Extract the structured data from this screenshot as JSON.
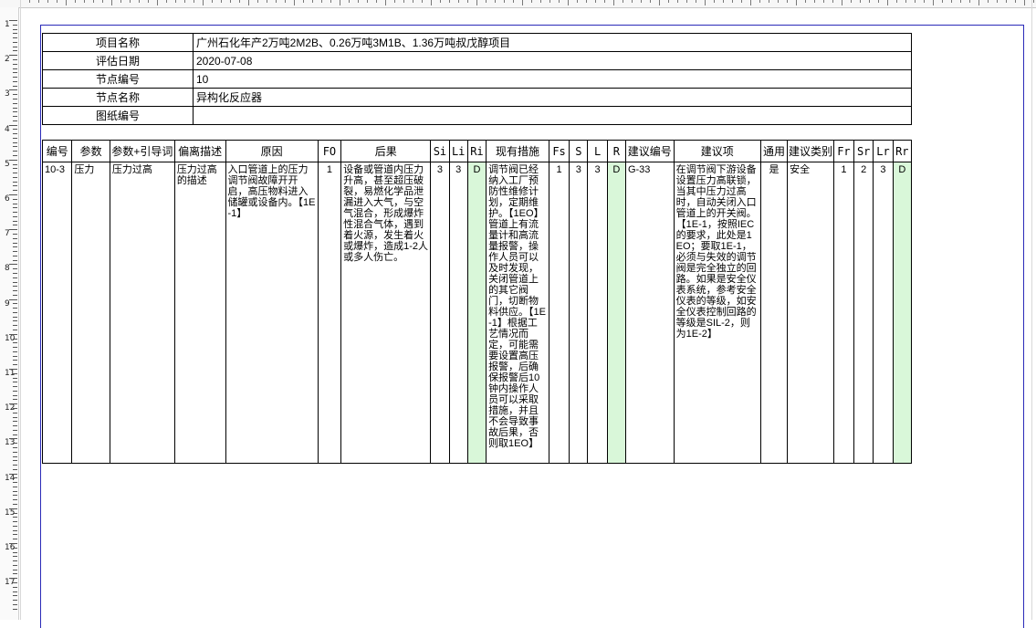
{
  "info": {
    "rows": [
      {
        "label": "项目名称",
        "value": "广州石化年产2万吨2M2B、0.26万吨3M1B、1.36万吨叔戊醇项目"
      },
      {
        "label": "评估日期",
        "value": "2020-07-08"
      },
      {
        "label": "节点编号",
        "value": "10"
      },
      {
        "label": "节点名称",
        "value": "异构化反应器"
      },
      {
        "label": "图纸编号",
        "value": ""
      }
    ]
  },
  "table": {
    "headers": [
      "编号",
      "参数",
      "参数+引导词",
      "偏离描述",
      "原因",
      "FO",
      "后果",
      "Si",
      "Li",
      "Ri",
      "现有措施",
      "Fs",
      "S",
      "L",
      "R",
      "建议编号",
      "建议项",
      "通用",
      "建议类别",
      "Fr",
      "Sr",
      "Lr",
      "Rr"
    ],
    "row": {
      "id": "10-3",
      "param": "压力",
      "param_guide": "压力过高",
      "deviation": "压力过高的描述",
      "cause": "入口管道上的压力调节阀故障开开启，高压物料进入储罐或设备内。【1E-1】",
      "fo": "1",
      "consequence": "设备或管道内压力升高，甚至超压破裂，易燃化学品泄漏进入大气，与空气混合，形成爆炸性混合气体，遇到着火源，发生着火或爆炸，造成1-2人或多人伤亡。",
      "si": "3",
      "li": "3",
      "ri": "D",
      "measures": "调节阀已经纳入工厂预防性维修计划，定期维护。【1EO】管道上有流量计和高流量报警，操作人员可以及时发现，关闭管道上的其它阀门，切断物料供应。【1E-1】根据工艺情况而定，可能需要设置高压报警，后确保报警后10钟内操作人员可以采取措施，并且不会导致事故后果，否则取1EO】",
      "fs": "1",
      "s": "3",
      "l": "3",
      "r": "D",
      "rec_id": "G-33",
      "recommendation": "在调节阀下游设备设置压力高联锁，当其中压力过高时，自动关闭入口管道上的开关阀。【1E-1，按照IEC的要求，此处是1EO；要取1E-1，必须与失效的调节阀是完全独立的回路。如果是安全仪表系统，参考安全仪表的等级，如安全仪表控制回路的等级是SIL-2，则为1E-2】",
      "general": "是",
      "category": "安全",
      "fr": "1",
      "sr": "2",
      "lr": "3",
      "rr": "D"
    }
  },
  "ruler": {
    "left_numbers": [
      "1",
      "2",
      "3",
      "4",
      "5",
      "6",
      "7",
      "8",
      "9",
      "10",
      "11",
      "12",
      "13",
      "14",
      "15",
      "16",
      "17"
    ]
  },
  "colors": {
    "page_border": "#2a2ab8",
    "risk_cell_bg": "#d9f7d9"
  }
}
